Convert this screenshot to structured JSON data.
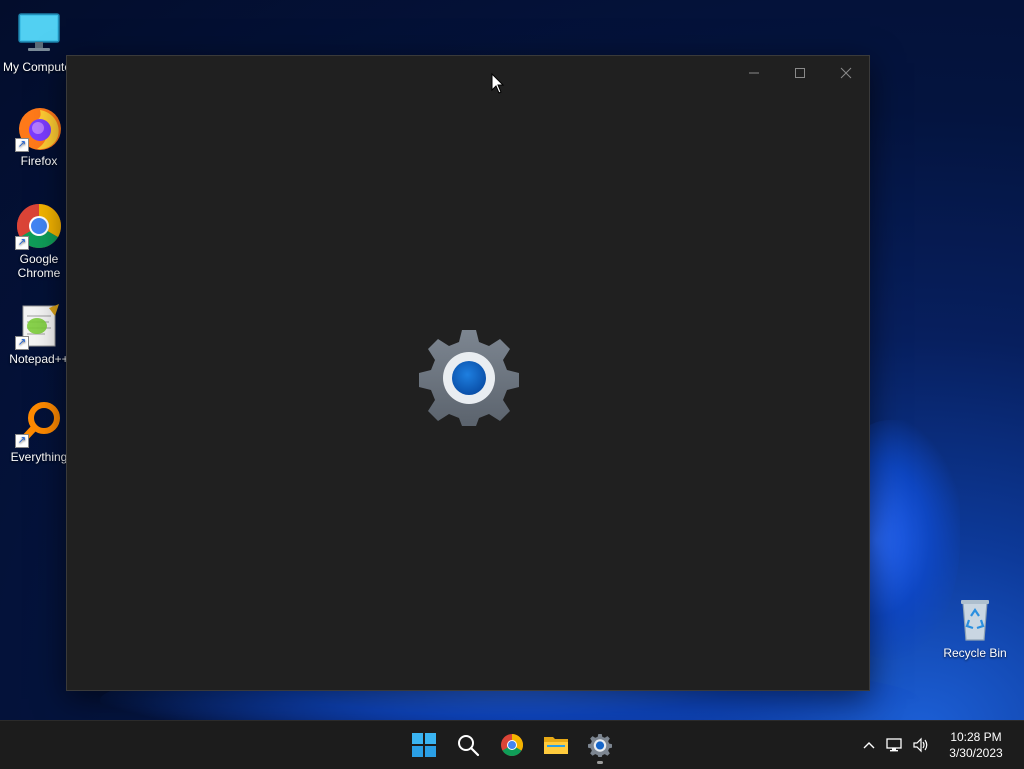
{
  "desktop": {
    "icons": [
      {
        "label": "My Computer",
        "icon": "monitor-icon"
      },
      {
        "label": "Firefox",
        "icon": "firefox-icon"
      },
      {
        "label": "Google Chrome",
        "icon": "chrome-icon"
      },
      {
        "label": "Notepad++",
        "icon": "notepad-plus-plus-icon"
      },
      {
        "label": "Everything",
        "icon": "everything-search-icon"
      },
      {
        "label": "Recycle Bin",
        "icon": "recycle-bin-icon"
      }
    ]
  },
  "window": {
    "app": "Settings",
    "state": "loading-splash",
    "splash_icon": "settings-gear-icon",
    "controls": [
      "minimize",
      "maximize",
      "close"
    ]
  },
  "taskbar": {
    "pinned": [
      {
        "name": "start",
        "icon": "windows-start-icon"
      },
      {
        "name": "search",
        "icon": "search-icon"
      },
      {
        "name": "chrome",
        "icon": "chrome-icon"
      },
      {
        "name": "file-explorer",
        "icon": "folder-icon"
      },
      {
        "name": "settings",
        "icon": "settings-gear-icon",
        "active": true
      }
    ],
    "tray": {
      "icons": [
        "chevron-up-icon",
        "network-icon",
        "volume-icon"
      ],
      "time": "10:28 PM",
      "date": "3/30/2023"
    }
  },
  "colors": {
    "window_bg": "#202020",
    "taskbar_bg": "#1c1c1c",
    "accent": "#0a63c7"
  }
}
